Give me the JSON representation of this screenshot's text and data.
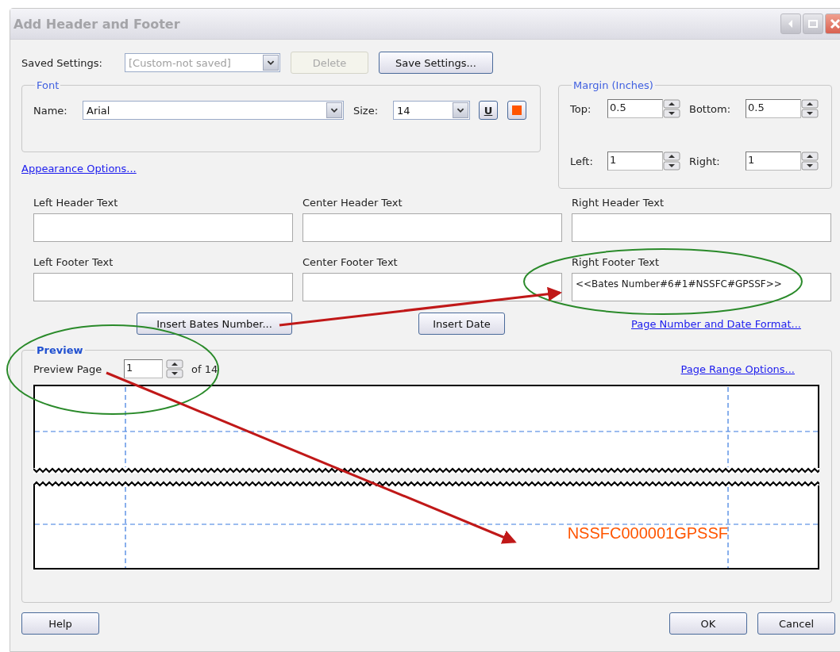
{
  "window": {
    "title": "Add Header and Footer"
  },
  "saved_settings": {
    "label": "Saved Settings:",
    "value": "[Custom-not saved]",
    "disabled": true
  },
  "top_buttons": [
    {
      "label": "Delete",
      "disabled": true
    },
    {
      "label": "Save Settings...",
      "disabled": false
    }
  ],
  "font": {
    "legend": "Font",
    "name_label": "Name:",
    "name": "Arial",
    "size_label": "Size:",
    "size": "14",
    "underline_glyph": "U",
    "color": "#ff5500"
  },
  "appearance_link": "Appearance Options...",
  "margin": {
    "legend": "Margin (Inches)",
    "fields": [
      {
        "label": "Top:",
        "value": "0.5"
      },
      {
        "label": "Bottom:",
        "value": "0.5"
      },
      {
        "label": "Left:",
        "value": "1"
      },
      {
        "label": "Right:",
        "value": "1"
      }
    ]
  },
  "text_fields": [
    {
      "label": "Left Header Text"
    },
    {
      "label": "Center Header Text"
    },
    {
      "label": "Right Header Text"
    },
    {
      "label": "Left Footer Text"
    },
    {
      "label": "Center Footer Text"
    },
    {
      "label": "Right Footer Text",
      "value": "<<Bates Number#6#1#NSSFC#GPSSF>>"
    }
  ],
  "insert_buttons": [
    "Insert Bates Number...",
    "Insert Date"
  ],
  "format_link": "Page Number and Date Format...",
  "preview": {
    "legend": "Preview",
    "page_label": "Preview Page",
    "page": "1",
    "of": "of 14",
    "range_link": "Page Range Options...",
    "footer_text": "NSSFC000001GPSSF"
  },
  "bottom_buttons": [
    "Help",
    "OK",
    "Cancel"
  ]
}
